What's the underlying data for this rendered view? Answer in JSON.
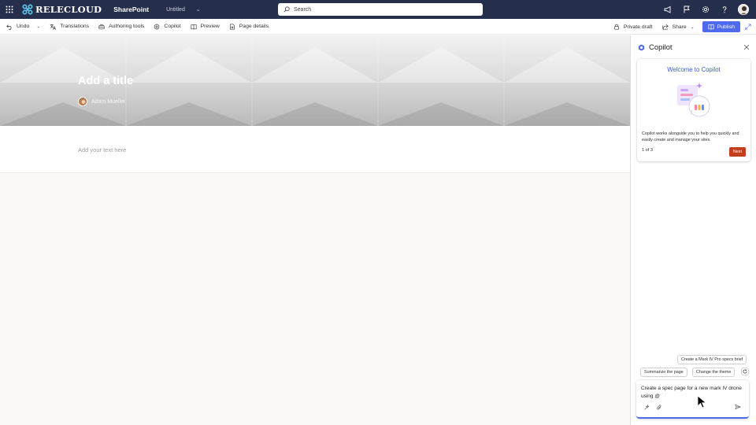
{
  "suite_bar": {
    "brand": "RELECLOUD",
    "app": "SharePoint",
    "page": "Untitled",
    "search_placeholder": "Search"
  },
  "command_bar": {
    "undo": "Undo",
    "translations": "Translations",
    "authoring_tools": "Authoring tools",
    "copilot": "Copilot",
    "preview": "Preview",
    "page_details": "Page details",
    "private_draft": "Private draft",
    "share": "Share",
    "publish": "Publish"
  },
  "canvas": {
    "title_placeholder": "Add a title",
    "author": "Adam Mueller",
    "text_placeholder": "Add your text here"
  },
  "copilot": {
    "header": "Copilot",
    "welcome_title": "Welcome to Copilot",
    "welcome_body": "Copilot works alongside you to help you quickly and easily create and manage your sites.",
    "step": "1 of 3",
    "next": "Next",
    "suggestions": [
      "Create a Mark IV Pro specs brief",
      "Summarize the page",
      "Change the theme"
    ],
    "compose_text": "Create a spec page for a new mark IV drone using @"
  },
  "colors": {
    "suite_bar": "#252e4a",
    "accent": "#4f6bed",
    "next_button": "#c43e1c",
    "copilot_title": "#3a5bd9"
  }
}
